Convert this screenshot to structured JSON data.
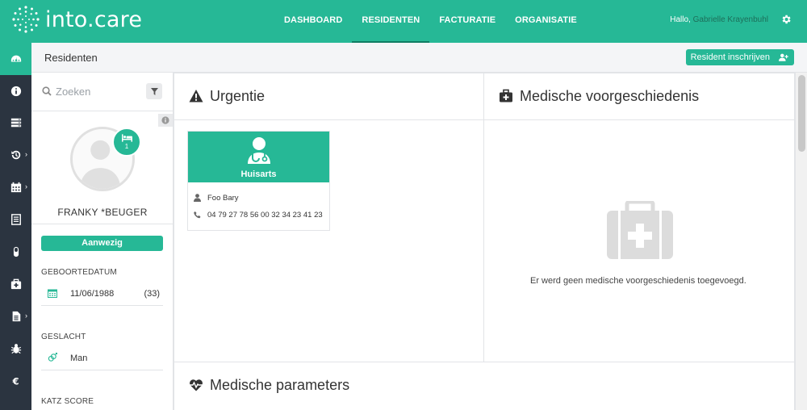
{
  "app": {
    "brand": "into.care"
  },
  "nav": {
    "links": [
      "DASHBOARD",
      "RESIDENTEN",
      "FACTURATIE",
      "ORGANISATIE"
    ],
    "active": "RESIDENTEN",
    "greeting_prefix": "Hallo,",
    "user_name": "Gabrielle Krayenbuhl"
  },
  "rail": {
    "items": [
      "dashboard-icon",
      "info-icon",
      "list-icon",
      "history-icon",
      "calendar-icon",
      "document-icon",
      "medication-icon",
      "medkit-icon",
      "file-icon",
      "bug-icon",
      "euro-icon"
    ],
    "active_index": 0
  },
  "subheader": {
    "title": "Residenten",
    "enroll_label": "Resident inschrijven"
  },
  "resident": {
    "search_placeholder": "Zoeken",
    "bed_count": "1",
    "name": "FRANKY *BEUGER",
    "status": "Aanwezig",
    "birthdate_label": "GEBOORTEDATUM",
    "birthdate": "11/06/1988",
    "age": "(33)",
    "gender_label": "GESLACHT",
    "gender": "Man",
    "katz_label": "KATZ SCORE"
  },
  "urgency": {
    "title": "Urgentie",
    "contact": {
      "role": "Huisarts",
      "name": "Foo Bary",
      "phone": "04 79 27 78 56 00 32 34 23 41 23"
    }
  },
  "medical_history": {
    "title": "Medische voorgeschiedenis",
    "empty_text": "Er werd geen medische voorgeschiedenis toegevoegd."
  },
  "medical_parameters": {
    "title": "Medische parameters"
  },
  "colors": {
    "accent": "#26b896",
    "rail": "#2b3440",
    "text": "#333333"
  }
}
